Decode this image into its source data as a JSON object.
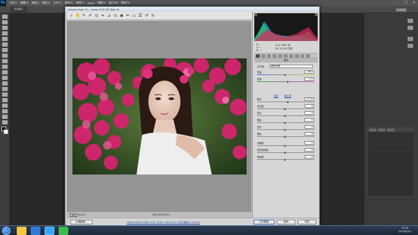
{
  "ps": {
    "logo": "Ps",
    "menu": [
      "文件(F)",
      "编辑(E)",
      "图像(I)",
      "图层(L)",
      "文字(Y)",
      "选择(S)",
      "滤镜(T)",
      "3D(D)",
      "视图(V)",
      "窗口(W)",
      "帮助(H)"
    ],
    "doc_tab": "未标题-1",
    "panel_chip": "基本功能"
  },
  "acr": {
    "title": "Camera Raw 7.0 - Canon EOS 5D Mark III",
    "tool_icons": [
      "zoom-icon",
      "hand-icon",
      "white-balance-icon",
      "color-sampler-icon",
      "target-adjust-icon",
      "crop-icon",
      "straighten-icon",
      "spot-removal-icon",
      "red-eye-icon",
      "adjustment-brush-icon",
      "graduated-filter-icon",
      "preferences-icon",
      "rotate-ccw-icon",
      "rotate-cw-icon"
    ],
    "statusbar": {
      "zoom": "16.3%",
      "filename": "IMG_0178.CR2"
    },
    "histogram_readout": {
      "rgb_labels": [
        "R:",
        "G:",
        "B:"
      ],
      "rgb_values": [
        "---",
        "---",
        "---"
      ],
      "exposure_line1": "f/1.8   1/800 秒",
      "exposure_line2": "ISO 100   85 毫米"
    },
    "basic_panel": {
      "title": "基本",
      "wb_label": "白平衡:",
      "wb_value": "原照设置",
      "temp_label": "色温",
      "temp_value": "4950",
      "tint_label": "色调",
      "tint_value": "+13",
      "auto_link": "自动",
      "default_link": "默认值",
      "sliders": [
        {
          "label": "曝光",
          "value": "+0.35",
          "pos": 0.55
        },
        {
          "label": "对比度",
          "value": "0",
          "pos": 0.5
        },
        {
          "label": "高光",
          "value": "0",
          "pos": 0.5
        },
        {
          "label": "阴影",
          "value": "0",
          "pos": 0.5
        },
        {
          "label": "白色",
          "value": "0",
          "pos": 0.5
        },
        {
          "label": "黑色",
          "value": "0",
          "pos": 0.5
        },
        {
          "label": "清晰度",
          "value": "0",
          "pos": 0.5
        },
        {
          "label": "自然饱和度",
          "value": "0",
          "pos": 0.5
        },
        {
          "label": "饱和度",
          "value": "0",
          "pos": 0.5
        }
      ]
    },
    "footer": {
      "save_label": "存储图像...",
      "workflow_text": "Adobe RGB (1998); 8 位; 5760 x 3840 (22.1 百万像素); 240 ppi",
      "open_label": "打开图像",
      "cancel_label": "取消",
      "done_label": "完成"
    }
  },
  "taskbar": {
    "time": "17:25",
    "date": "2015/5/14"
  }
}
